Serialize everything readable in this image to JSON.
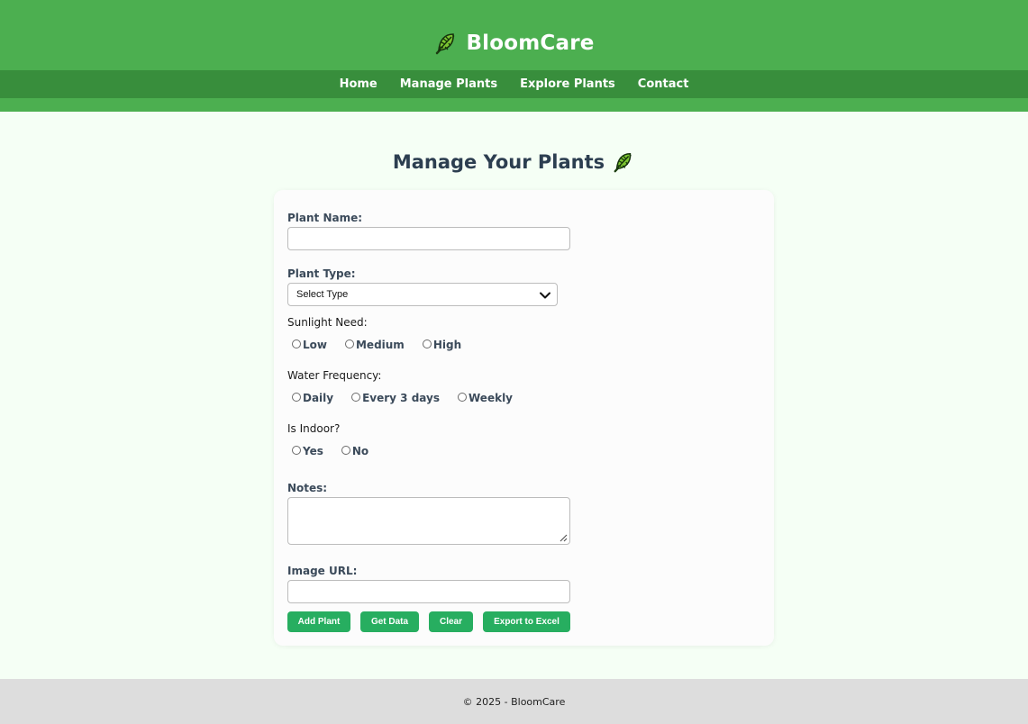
{
  "header": {
    "brand": "BloomCare",
    "brand_icon": "herb-leaf-icon",
    "nav": [
      "Home",
      "Manage Plants",
      "Explore Plants",
      "Contact"
    ]
  },
  "main": {
    "title": "Manage Your Plants",
    "title_icon": "herb-leaf-icon"
  },
  "form": {
    "plant_name_label": "Plant Name:",
    "plant_name_value": "",
    "plant_type_label": "Plant Type:",
    "plant_type_selected": "Select Type",
    "sunlight_label": "Sunlight Need:",
    "sunlight_options": [
      "Low",
      "Medium",
      "High"
    ],
    "water_label": "Water Frequency:",
    "water_options": [
      "Daily",
      "Every 3 days",
      "Weekly"
    ],
    "indoor_label": "Is Indoor?",
    "indoor_options": [
      "Yes",
      "No"
    ],
    "notes_label": "Notes:",
    "notes_value": "",
    "image_url_label": "Image URL:",
    "image_url_value": "",
    "buttons": [
      "Add Plant",
      "Get Data",
      "Clear",
      "Export to Excel"
    ]
  },
  "footer": {
    "text": "© 2025 - BloomCare"
  },
  "colors": {
    "header_green": "#4caf50",
    "nav_green": "#388e3c",
    "button_green": "#27ae60",
    "page_bg": "#f5fff5",
    "footer_bg": "#dddddd"
  }
}
